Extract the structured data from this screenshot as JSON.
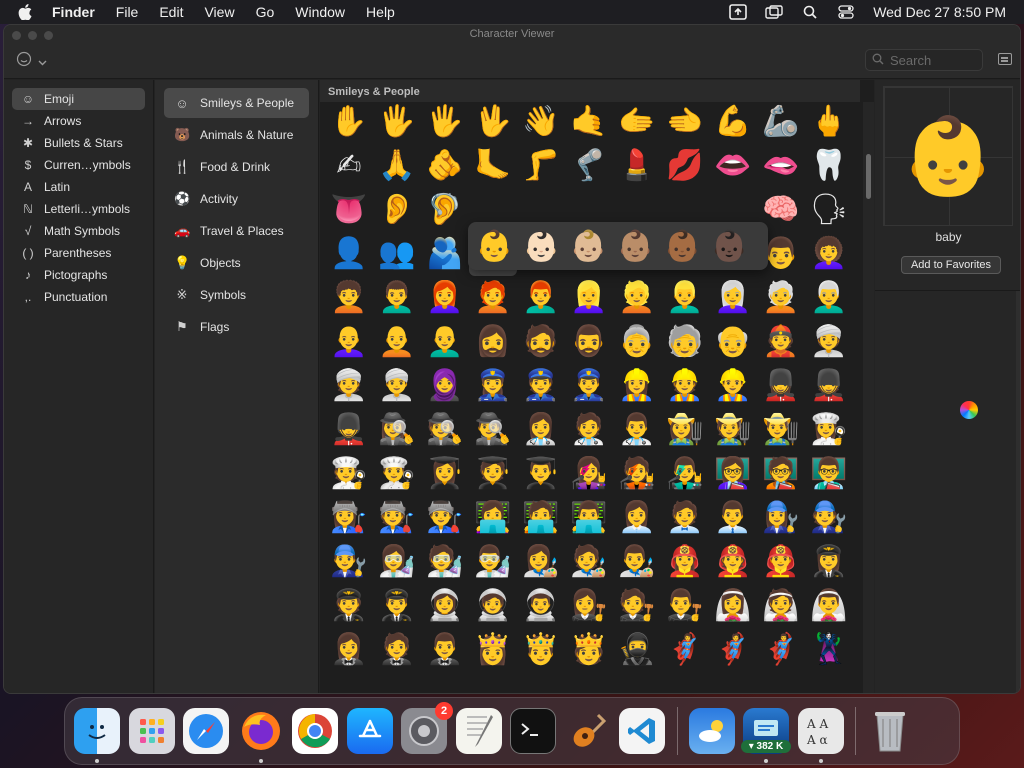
{
  "menubar": {
    "items": [
      "Finder",
      "File",
      "Edit",
      "View",
      "Go",
      "Window",
      "Help"
    ],
    "datetime": "Wed Dec 27  8:50 PM"
  },
  "window": {
    "title": "Character Viewer",
    "search_placeholder": "Search"
  },
  "sidebar": {
    "items": [
      {
        "icon": "☺",
        "label": "Emoji",
        "selected": true
      },
      {
        "icon": "→",
        "label": "Arrows"
      },
      {
        "icon": "✱",
        "label": "Bullets & Stars"
      },
      {
        "icon": "$",
        "label": "Curren…ymbols"
      },
      {
        "icon": "A",
        "label": "Latin"
      },
      {
        "icon": "ℕ",
        "label": "Letterli…ymbols"
      },
      {
        "icon": "√",
        "label": "Math Symbols"
      },
      {
        "icon": "( )",
        "label": "Parentheses"
      },
      {
        "icon": "♪",
        "label": "Pictographs"
      },
      {
        "icon": ",.",
        "label": "Punctuation"
      }
    ]
  },
  "categories": {
    "items": [
      {
        "icon": "☺",
        "label": "Smileys & People",
        "selected": true
      },
      {
        "icon": "🐻",
        "label": "Animals & Nature"
      },
      {
        "icon": "🍴",
        "label": "Food & Drink"
      },
      {
        "icon": "⚽",
        "label": "Activity"
      },
      {
        "icon": "🚗",
        "label": "Travel & Places"
      },
      {
        "icon": "💡",
        "label": "Objects"
      },
      {
        "icon": "※",
        "label": "Symbols"
      },
      {
        "icon": "⚑",
        "label": "Flags"
      }
    ]
  },
  "emoji_panel": {
    "header": "Smileys & People",
    "rows": [
      [
        "✋",
        "🖐",
        "🖐",
        "🖖",
        "👋",
        "🤙",
        "🫱",
        "🫲",
        "💪",
        "🦾",
        "🖕"
      ],
      [
        "✍",
        "🙏",
        "🫵",
        "🦶",
        "🦵",
        "🦿",
        "💄",
        "💋",
        "👄",
        "🫦",
        "🦷"
      ],
      [
        "👅",
        "👂",
        "🦻",
        "",
        "",
        "",
        "",
        "",
        "",
        "🧠",
        "🗣"
      ],
      [
        "👤",
        "👥",
        "🫂",
        "👶",
        "👧",
        "🧒",
        "👦",
        "👩",
        "🧑",
        "👨",
        "👩‍🦱"
      ],
      [
        "🧑‍🦱",
        "👨‍🦱",
        "👩‍🦰",
        "🧑‍🦰",
        "👨‍🦰",
        "👱‍♀️",
        "👱",
        "👱‍♂️",
        "👩‍🦳",
        "🧑‍🦳",
        "👨‍🦳"
      ],
      [
        "👩‍🦲",
        "🧑‍🦲",
        "👨‍🦲",
        "🧔‍♀️",
        "🧔",
        "🧔‍♂️",
        "👵",
        "🧓",
        "👴",
        "👲",
        "👳‍♀️"
      ],
      [
        "👳",
        "👳‍♂️",
        "🧕",
        "👮‍♀️",
        "👮",
        "👮‍♂️",
        "👷‍♀️",
        "👷",
        "👷‍♂️",
        "💂‍♀️",
        "💂"
      ],
      [
        "💂‍♂️",
        "🕵️‍♀️",
        "🕵️",
        "🕵️‍♂️",
        "👩‍⚕️",
        "🧑‍⚕️",
        "👨‍⚕️",
        "👩‍🌾",
        "🧑‍🌾",
        "👨‍🌾",
        "👩‍🍳"
      ],
      [
        "🧑‍🍳",
        "👨‍🍳",
        "👩‍🎓",
        "🧑‍🎓",
        "👨‍🎓",
        "👩‍🎤",
        "🧑‍🎤",
        "👨‍🎤",
        "👩‍🏫",
        "🧑‍🏫",
        "👨‍🏫"
      ],
      [
        "👩‍🏭",
        "🧑‍🏭",
        "👨‍🏭",
        "👩‍💻",
        "🧑‍💻",
        "👨‍💻",
        "👩‍💼",
        "🧑‍💼",
        "👨‍💼",
        "👩‍🔧",
        "🧑‍🔧"
      ],
      [
        "👨‍🔧",
        "👩‍🔬",
        "🧑‍🔬",
        "👨‍🔬",
        "👩‍🎨",
        "🧑‍🎨",
        "👨‍🎨",
        "👩‍🚒",
        "🧑‍🚒",
        "👨‍🚒",
        "👩‍✈️"
      ],
      [
        "🧑‍✈️",
        "👨‍✈️",
        "👩‍🚀",
        "🧑‍🚀",
        "👨‍🚀",
        "👩‍⚖️",
        "🧑‍⚖️",
        "👨‍⚖️",
        "👰‍♀️",
        "👰",
        "👰‍♂️"
      ],
      [
        "🤵‍♀️",
        "🤵",
        "🤵‍♂️",
        "👸",
        "🤴",
        "🫅",
        "🥷",
        "🦸‍♀️",
        "🦸",
        "🦸‍♂️",
        "🦹‍♀️"
      ]
    ],
    "selected_cell": {
      "row": 3,
      "col": 3
    },
    "skin_tones": [
      "👶",
      "👶🏻",
      "👶🏼",
      "👶🏽",
      "👶🏾",
      "👶🏿"
    ]
  },
  "inspector": {
    "preview": "👶",
    "name": "baby",
    "favorites_button": "Add to Favorites"
  },
  "dock": {
    "apps": [
      {
        "name": "Finder",
        "running": true
      },
      {
        "name": "Launchpad"
      },
      {
        "name": "Safari"
      },
      {
        "name": "Firefox",
        "running": true
      },
      {
        "name": "Chrome"
      },
      {
        "name": "App Store"
      },
      {
        "name": "System Settings",
        "badge": "2"
      },
      {
        "name": "TextEdit"
      },
      {
        "name": "Terminal"
      },
      {
        "name": "GarageBand"
      },
      {
        "name": "VS Code"
      }
    ],
    "extras": [
      {
        "name": "Weather"
      },
      {
        "name": "Network Monitor",
        "badge_text": "▾ 382 K",
        "running": true
      },
      {
        "name": "Character Viewer",
        "running": true
      }
    ],
    "trash": "Trash"
  }
}
